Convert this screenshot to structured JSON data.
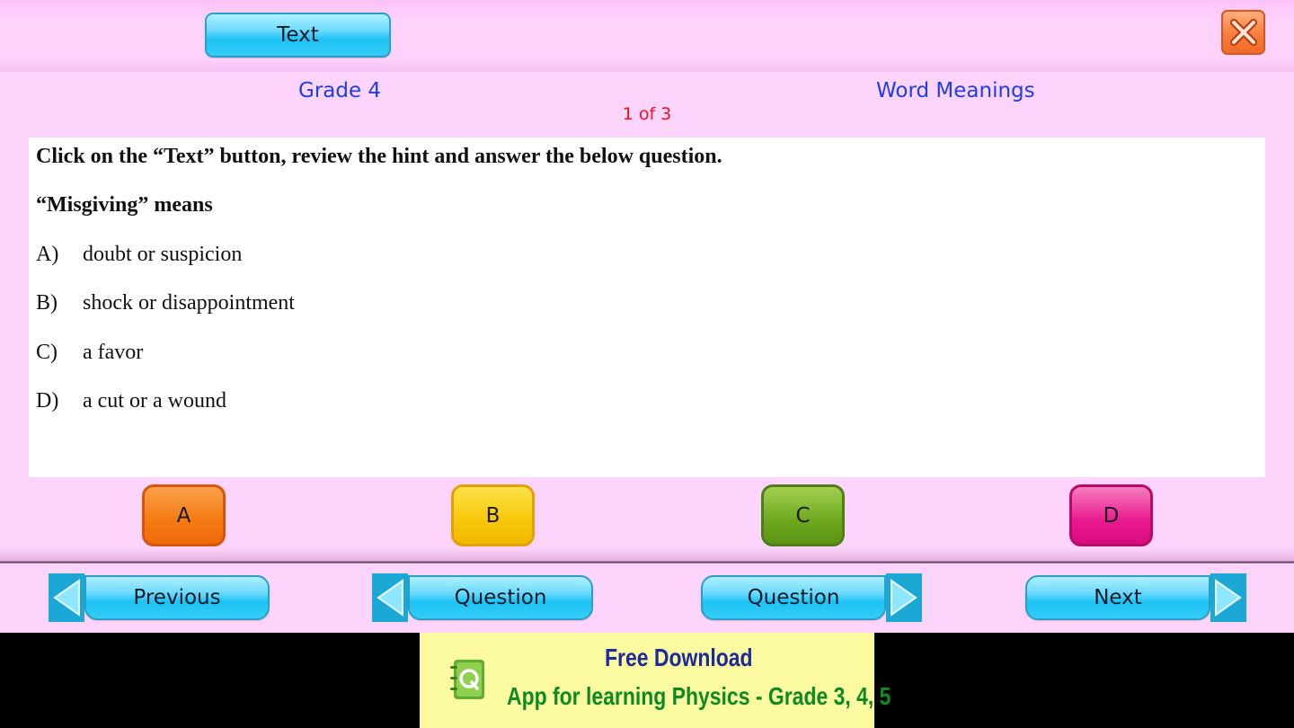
{
  "toolbar": {
    "text_button": "Text",
    "close_icon": "close-x-icon"
  },
  "header": {
    "grade": "Grade 4",
    "topic": "Word Meanings",
    "counter": "1 of 3"
  },
  "question": {
    "instruction": "Click on the “Text” button, review the hint and answer the below question.",
    "stem": "“Misgiving” means",
    "options": [
      {
        "letter": "A)",
        "text": "doubt or suspicion"
      },
      {
        "letter": "B)",
        "text": "shock or disappointment"
      },
      {
        "letter": "C)",
        "text": "a favor"
      },
      {
        "letter": "D)",
        "text": "a cut or a wound"
      }
    ]
  },
  "answers": [
    {
      "label": "A",
      "color": "#f47a12"
    },
    {
      "label": "B",
      "color": "#f8c70a"
    },
    {
      "label": "C",
      "color": "#6ea81e"
    },
    {
      "label": "D",
      "color": "#e8198d"
    }
  ],
  "nav": {
    "previous": "Previous",
    "prev_question": "Question",
    "next_question": "Question",
    "next": "Next"
  },
  "ad": {
    "line1": "Free Download",
    "line2": "App for learning Physics - Grade 3, 4, 5",
    "logo_icon": "notebook-q-icon"
  }
}
